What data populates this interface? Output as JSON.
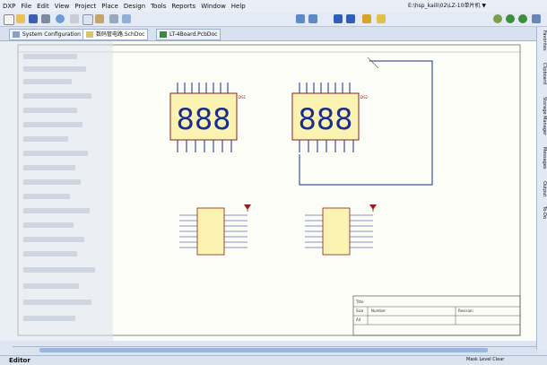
{
  "menu": {
    "items": [
      "DXP",
      "File",
      "Edit",
      "View",
      "Project",
      "Place",
      "Design",
      "Tools",
      "Reports",
      "Window",
      "Help"
    ]
  },
  "toolbar": {
    "path": "E:\\hsp_kaili\\02\\LZ-10单片机 ▼"
  },
  "tabs": [
    {
      "label": "System Configuration"
    },
    {
      "label": "数码管电路.SchDoc"
    },
    {
      "label": "LT-4Board.PcbDoc"
    }
  ],
  "right_panels": [
    "Favorites",
    "Clipboard",
    "Storage Manager",
    "Messages",
    "Output",
    "To-Do"
  ],
  "displays": [
    {
      "digits": "888",
      "ref": "DS1"
    },
    {
      "digits": "888",
      "ref": "DS2"
    }
  ],
  "title_block": {
    "title_label": "Title",
    "size_label": "Size",
    "number_label": "Number",
    "revision_label": "Revision",
    "size_value": "A4"
  },
  "statusbar": {
    "left": "Editor",
    "right": "Mask Level  Clear"
  },
  "colors": {
    "component_fill": "#fbf3b2",
    "component_stroke": "#8a1f1f",
    "wire": "#1c2d8c",
    "power": "#9a1c1c"
  }
}
